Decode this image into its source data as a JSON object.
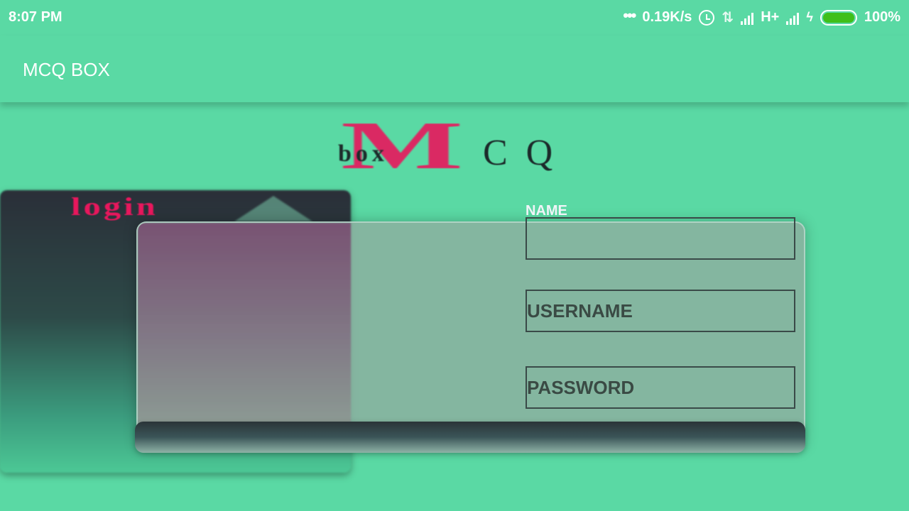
{
  "status_bar": {
    "time": "8:07 PM",
    "net_speed": "0.19K/s",
    "network_type": "H+",
    "battery": "100%",
    "battery_color": "#3fbf1a",
    "icons": [
      "more-dots-icon",
      "alarm-icon",
      "data-transfer-icon",
      "signal-icon",
      "bolt-icon",
      "battery-icon"
    ]
  },
  "app_bar": {
    "title": "MCQ BOX"
  },
  "logo": {
    "m": "M",
    "box": "box",
    "cq": "CQ"
  },
  "card": {
    "title": "login"
  },
  "form": {
    "name_label": "NAME",
    "name_value": "",
    "username_placeholder": "USERNAME",
    "password_placeholder": "PASSWORD"
  },
  "colors": {
    "background": "#5ad9a4",
    "accent": "#e8175d",
    "text_dark": "#3a4a44"
  }
}
